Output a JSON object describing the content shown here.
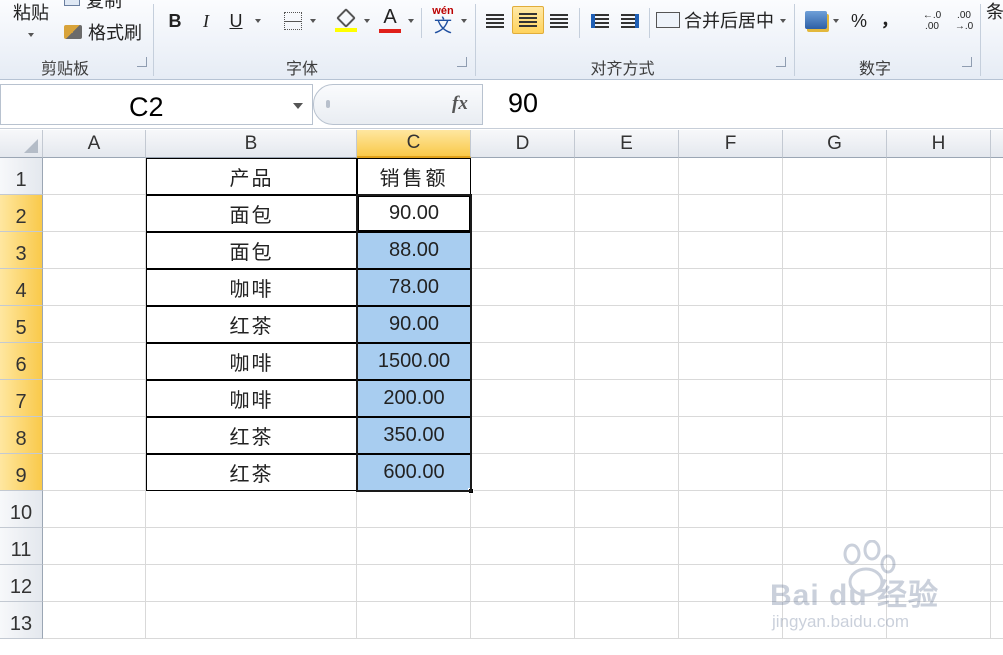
{
  "ribbon": {
    "clipboard": {
      "paste_label": "粘贴",
      "copy_label": "复制",
      "format_painter_label": "格式刷",
      "group_label": "剪贴板"
    },
    "font": {
      "bold": "B",
      "italic": "I",
      "underline": "U",
      "font_color_glyph": "A",
      "phonetic_top": "wén",
      "phonetic_bottom": "文",
      "group_label": "字体"
    },
    "alignment": {
      "merge_center_label": "合并后居中",
      "group_label": "对齐方式"
    },
    "number": {
      "percent": "%",
      "comma": "，",
      "inc_decimal": "←.0\n.00",
      "dec_decimal": ".00\n→.0",
      "group_label": "数字"
    },
    "cutoff_label": "条"
  },
  "formula_bar": {
    "name_box": "C2",
    "fx": "fx",
    "formula": "90"
  },
  "columns": [
    {
      "label": "A",
      "selected": false
    },
    {
      "label": "B",
      "selected": false
    },
    {
      "label": "C",
      "selected": true
    },
    {
      "label": "D",
      "selected": false
    },
    {
      "label": "E",
      "selected": false
    },
    {
      "label": "F",
      "selected": false
    },
    {
      "label": "G",
      "selected": false
    },
    {
      "label": "H",
      "selected": false
    }
  ],
  "rows": [
    {
      "num": "1",
      "selected": false,
      "b": "产品",
      "c": "销售额"
    },
    {
      "num": "2",
      "selected": true,
      "b": "面包",
      "c": "90.00"
    },
    {
      "num": "3",
      "selected": true,
      "b": "面包",
      "c": "88.00"
    },
    {
      "num": "4",
      "selected": true,
      "b": "咖啡",
      "c": "78.00"
    },
    {
      "num": "5",
      "selected": true,
      "b": "红茶",
      "c": "90.00"
    },
    {
      "num": "6",
      "selected": true,
      "b": "咖啡",
      "c": "1500.00"
    },
    {
      "num": "7",
      "selected": true,
      "b": "咖啡",
      "c": "200.00"
    },
    {
      "num": "8",
      "selected": true,
      "b": "红茶",
      "c": "350.00"
    },
    {
      "num": "9",
      "selected": true,
      "b": "红茶",
      "c": "600.00"
    },
    {
      "num": "10",
      "selected": false,
      "b": "",
      "c": ""
    },
    {
      "num": "11",
      "selected": false,
      "b": "",
      "c": ""
    },
    {
      "num": "12",
      "selected": false,
      "b": "",
      "c": ""
    },
    {
      "num": "13",
      "selected": false,
      "b": "",
      "c": ""
    }
  ],
  "watermark": {
    "brand": "Bai du 经验",
    "url": "jingyan.baidu.com"
  },
  "colors": {
    "selection_fill": "#a8cdf0",
    "header_selected": "#f9c94a"
  }
}
